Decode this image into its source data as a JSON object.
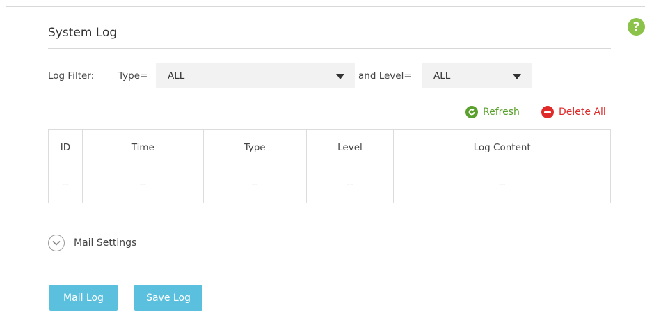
{
  "help": {
    "glyph": "?"
  },
  "page": {
    "title": "System Log"
  },
  "filter": {
    "label": "Log Filter:",
    "type_label": "Type=",
    "type_value": "ALL",
    "level_label": "and Level=",
    "level_value": "ALL"
  },
  "actions": {
    "refresh": "Refresh",
    "delete_all": "Delete All"
  },
  "table": {
    "headers": [
      "ID",
      "Time",
      "Type",
      "Level",
      "Log Content"
    ],
    "rows": [
      [
        "--",
        "--",
        "--",
        "--",
        "--"
      ]
    ]
  },
  "mail_settings": {
    "label": "Mail Settings"
  },
  "buttons": {
    "mail_log": "Mail Log",
    "save_log": "Save Log"
  },
  "colors": {
    "accent_button": "#5bc0de",
    "refresh": "#5aa02c",
    "delete": "#e02a2a",
    "help": "#8bc34a"
  }
}
